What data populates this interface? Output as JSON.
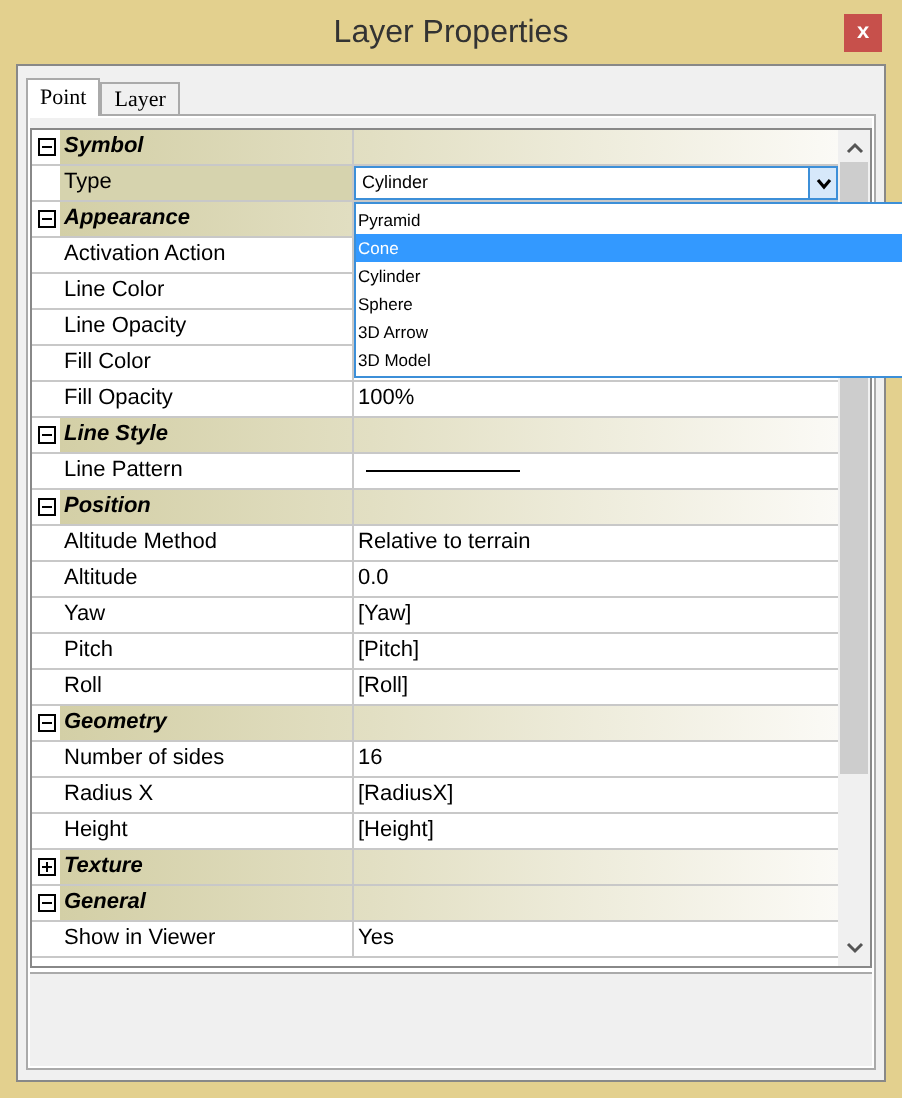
{
  "window": {
    "title": "Layer Properties",
    "close": "x"
  },
  "tabs": [
    {
      "label": "Point",
      "selected": true
    },
    {
      "label": "Layer",
      "selected": false
    }
  ],
  "sections": [
    {
      "title": "Symbol",
      "expanded": true,
      "rows": [
        {
          "name": "Type",
          "kind": "dropdown",
          "value": "Cylinder",
          "selected": true
        }
      ]
    },
    {
      "title": "Appearance",
      "expanded": true,
      "rows": [
        {
          "name": "Activation Action",
          "kind": "text",
          "selected": false
        },
        {
          "name": "Line Color",
          "kind": "text",
          "selected": false
        },
        {
          "name": "Line Opacity",
          "kind": "text",
          "selected": false
        },
        {
          "name": "Fill Color",
          "kind": "text",
          "selected": false
        },
        {
          "name": "Fill Opacity",
          "kind": "text",
          "value": "100%",
          "selected": false
        }
      ]
    },
    {
      "title": "Line Style",
      "expanded": true,
      "rows": [
        {
          "name": "Line Pattern",
          "kind": "line",
          "selected": false
        }
      ]
    },
    {
      "title": "Position",
      "expanded": true,
      "rows": [
        {
          "name": "Altitude Method",
          "kind": "text",
          "value": "Relative to terrain",
          "selected": false
        },
        {
          "name": "Altitude",
          "kind": "text",
          "value": "0.0",
          "selected": false
        },
        {
          "name": "Yaw",
          "kind": "text",
          "value": "[Yaw]",
          "selected": false
        },
        {
          "name": "Pitch",
          "kind": "text",
          "value": "[Pitch]",
          "selected": false
        },
        {
          "name": "Roll",
          "kind": "text",
          "value": "[Roll]",
          "selected": false
        }
      ]
    },
    {
      "title": "Geometry",
      "expanded": true,
      "rows": [
        {
          "name": "Number of sides",
          "kind": "text",
          "value": "16",
          "selected": false
        },
        {
          "name": "Radius X",
          "kind": "text",
          "value": "[RadiusX]",
          "selected": false
        },
        {
          "name": "Height",
          "kind": "text",
          "value": "[Height]",
          "selected": false
        }
      ]
    },
    {
      "title": "Texture",
      "expanded": false
    },
    {
      "title": "General",
      "expanded": true,
      "rows": [
        {
          "name": "Show in Viewer",
          "kind": "text",
          "value": "Yes",
          "selected": false
        }
      ]
    }
  ],
  "dropdown": {
    "items": [
      {
        "label": "Pyramid",
        "selected": false
      },
      {
        "label": "Cone",
        "selected": true
      },
      {
        "label": "Cylinder",
        "selected": false
      },
      {
        "label": "Sphere",
        "selected": false
      },
      {
        "label": "3D Arrow",
        "selected": false
      },
      {
        "label": "3D Model",
        "selected": false
      }
    ]
  }
}
